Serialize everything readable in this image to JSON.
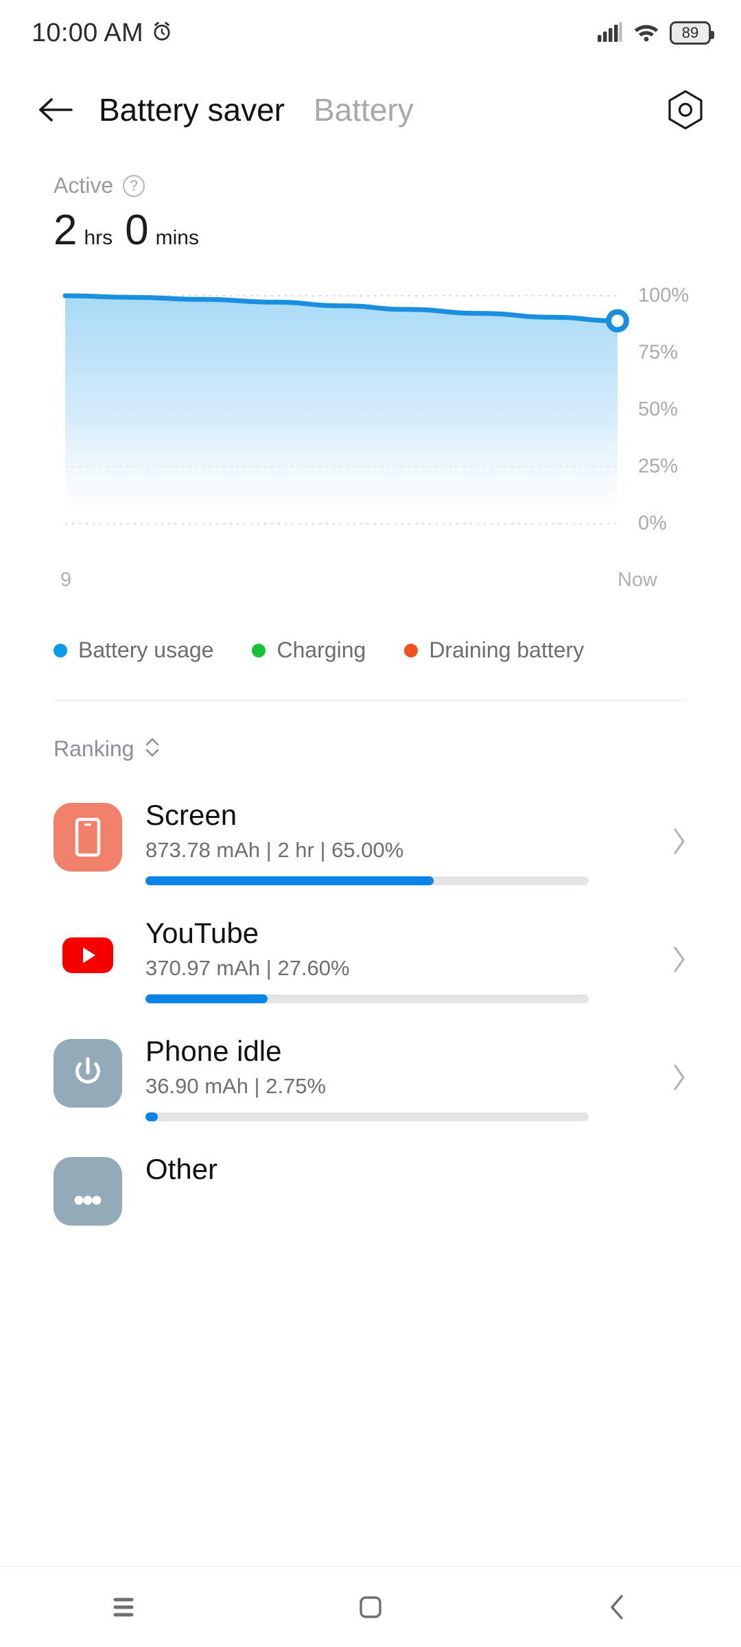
{
  "statusbar": {
    "time": "10:00 AM",
    "alarm_icon": "alarm-icon",
    "signal_icon": "signal-bars-icon",
    "wifi_icon": "wifi-icon",
    "battery_level": "89"
  },
  "header": {
    "back_icon": "back-arrow-icon",
    "title": "Battery saver",
    "alt_tab": "Battery",
    "settings_icon": "gear-icon"
  },
  "summary": {
    "status_label": "Active",
    "help_icon": "question-mark-icon",
    "hours_value": "2",
    "hours_unit": "hrs",
    "minutes_value": "0",
    "minutes_unit": "mins"
  },
  "chart_data": {
    "type": "area",
    "title": "",
    "xlabel": "",
    "ylabel": "",
    "ylim": [
      0,
      100
    ],
    "grid": true,
    "y_ticks": [
      "100%",
      "75%",
      "50%",
      "25%",
      "0%"
    ],
    "y_tick_values": [
      100,
      75,
      50,
      25,
      0
    ],
    "x_tick_labels": [
      "9",
      "Now"
    ],
    "series": [
      {
        "name": "Battery usage",
        "color": "#1a8fe0",
        "fill_color": "#b5e0f7",
        "x": [
          0,
          0.12,
          0.25,
          0.38,
          0.5,
          0.62,
          0.75,
          0.88,
          1.0
        ],
        "values": [
          100,
          99.3,
          98.4,
          97.2,
          95.6,
          94.0,
          92.3,
          90.6,
          89
        ]
      }
    ],
    "endpoint_marker": {
      "value": 89,
      "color": "#1a8fe0",
      "inner": "#ffffff"
    },
    "legend_position": "below"
  },
  "legend": [
    {
      "label": "Battery usage",
      "color": "#0b9ae8"
    },
    {
      "label": "Charging",
      "color": "#13c237"
    },
    {
      "label": "Draining battery",
      "color": "#f4511e"
    }
  ],
  "ranking": {
    "label": "Ranking",
    "sort_icon": "sort-updown-icon"
  },
  "apps": [
    {
      "name": "Screen",
      "meta": "873.78 mAh | 2 hr  | 65.00%",
      "percent": 65.0,
      "icon_name": "screen-icon",
      "icon_bg": "#f0806a",
      "chevron_icon": "chevron-right-icon"
    },
    {
      "name": "YouTube",
      "meta": "370.97 mAh | 27.60%",
      "percent": 27.6,
      "icon_name": "youtube-icon",
      "icon_bg": "#ffffff",
      "chevron_icon": "chevron-right-icon"
    },
    {
      "name": "Phone idle",
      "meta": "36.90 mAh | 2.75%",
      "percent": 2.75,
      "icon_name": "power-icon",
      "icon_bg": "#93aab9",
      "chevron_icon": "chevron-right-icon"
    },
    {
      "name": "Other",
      "meta": "",
      "percent": 0,
      "icon_name": "other-dots-icon",
      "icon_bg": "#93aab9",
      "chevron_icon": "chevron-right-icon"
    }
  ],
  "navbar": {
    "recents_icon": "menu-icon",
    "home_icon": "home-square-icon",
    "back_icon": "nav-back-chevron-icon"
  }
}
